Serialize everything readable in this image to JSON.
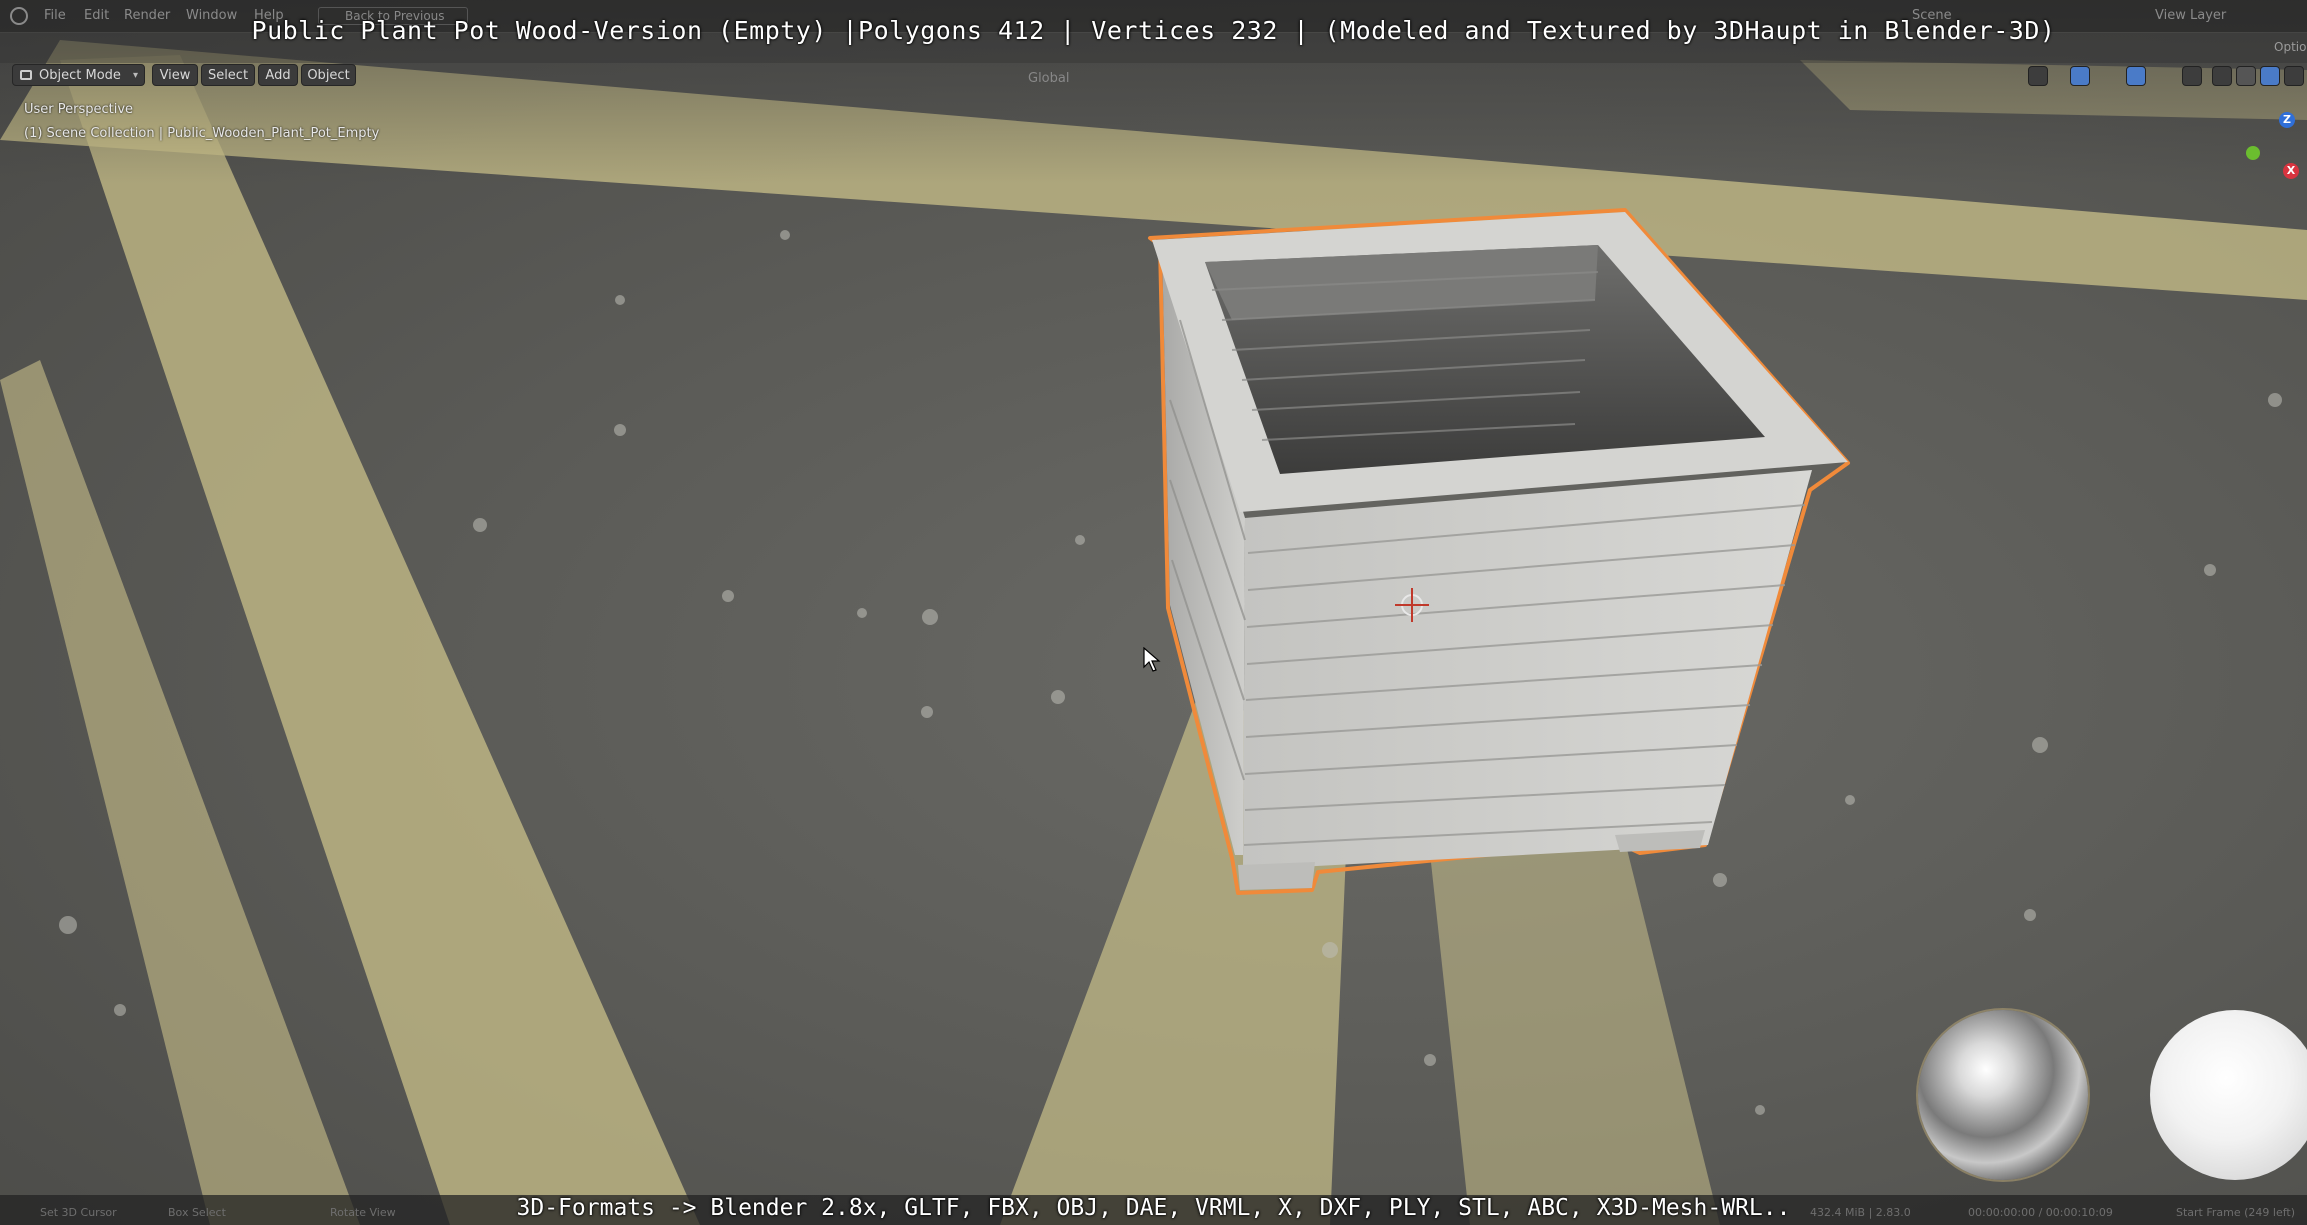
{
  "overlay": {
    "title": "Public Plant Pot Wood-Version (Empty) |Polygons 412 | Vertices 232 | (Modeled and Textured by 3DHaupt in Blender-3D)",
    "subtitle": "3D-Formats -> Blender 2.8x, GLTF, FBX, OBJ, DAE, VRML, X, DXF, PLY, STL, ABC, X3D-Mesh-WRL.."
  },
  "topbar": {
    "menus": [
      "File",
      "Edit",
      "Render",
      "Window",
      "Help"
    ],
    "back_to_previous": "Back to Previous",
    "scene": "Scene",
    "view_layer": "View Layer",
    "options": "Optio"
  },
  "header": {
    "mode": "Object Mode",
    "view": "View",
    "select": "Select",
    "add": "Add",
    "object": "Object",
    "orientation": "Global"
  },
  "viewport": {
    "perspective": "User Perspective",
    "collection": "(1) Scene Collection | Public_Wooden_Plant_Pot_Empty"
  },
  "gizmo": {
    "z": "Z",
    "x": "X",
    "colors": {
      "z": "#2f6fd8",
      "x": "#d8343f",
      "y": "#6bbd2f"
    }
  },
  "statusbar": {
    "left": [
      "Set 3D Cursor",
      "Box Select",
      "Rotate View"
    ],
    "right": [
      "432.4 MiB | 2.83.0",
      "00:00:00:00 / 00:00:10:09",
      "Start Frame (249 left)"
    ]
  },
  "colors": {
    "selection_outline": "#f08a3a",
    "road_marking": "#c9c08a",
    "asphalt": "#5c5c58"
  }
}
